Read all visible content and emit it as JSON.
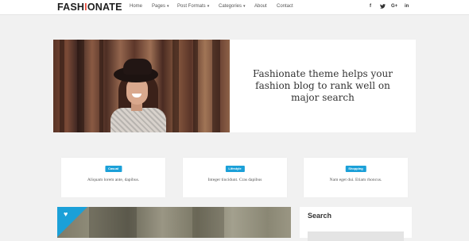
{
  "header": {
    "logo": {
      "part1": "FASH",
      "accent": "I",
      "part2": "ONATE",
      "accent_color": "#e84a3a"
    },
    "nav": [
      {
        "label": "Home",
        "has_dropdown": false
      },
      {
        "label": "Pages",
        "has_dropdown": true
      },
      {
        "label": "Post Formats",
        "has_dropdown": true
      },
      {
        "label": "Categories",
        "has_dropdown": true
      },
      {
        "label": "About",
        "has_dropdown": false
      },
      {
        "label": "Contact",
        "has_dropdown": false
      }
    ],
    "dropdown_glyph": "▾",
    "social": [
      {
        "icon": "facebook-icon",
        "glyph": "f"
      },
      {
        "icon": "twitter-icon",
        "glyph": "🐦"
      },
      {
        "icon": "google-plus-icon",
        "glyph": "G+"
      },
      {
        "icon": "linkedin-icon",
        "glyph": "in"
      }
    ]
  },
  "hero": {
    "text": "Fashionate theme helps your fashion blog to rank well on major search"
  },
  "cards": [
    {
      "badge": "Casual",
      "text": "Aliquam lorem ante, dapibus."
    },
    {
      "badge": "Lifestyle",
      "text": "Integer tincidunt. Cras dapibus"
    },
    {
      "badge": "Shopping",
      "text": "Nam eget dui. Etiam rhoncus."
    }
  ],
  "post": {
    "icon": "heart-icon",
    "glyph": "♥"
  },
  "sidebar": {
    "search_title": "Search",
    "search_placeholder": ""
  },
  "colors": {
    "accent_blue": "#1ba0d8",
    "background": "#f1f1f1"
  }
}
